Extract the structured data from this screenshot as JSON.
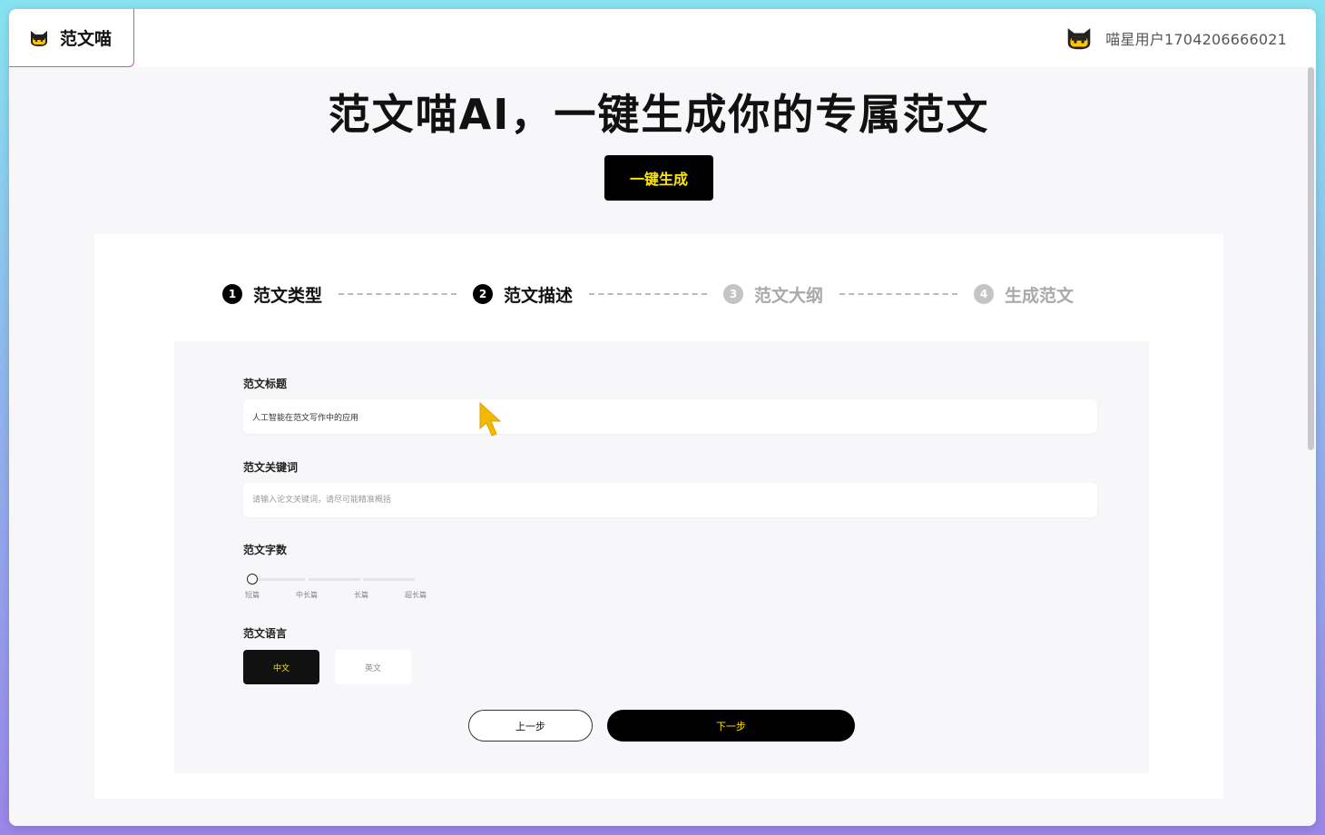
{
  "header": {
    "brand_name": "范文喵",
    "brand_icon": "cat-logo-icon",
    "user_name": "喵星用户1704206666021",
    "user_icon": "cat-avatar-icon"
  },
  "hero": {
    "title": "范文喵AI，一键生成你的专属范文",
    "button_label": "一键生成"
  },
  "steps": [
    {
      "num": "1",
      "label": "范文类型",
      "state": "done"
    },
    {
      "num": "2",
      "label": "范文描述",
      "state": "current"
    },
    {
      "num": "3",
      "label": "范文大纲",
      "state": "pending"
    },
    {
      "num": "4",
      "label": "生成范文",
      "state": "pending"
    }
  ],
  "form": {
    "title_label": "范文标题",
    "title_value": "人工智能在范文写作中的应用",
    "keywords_label": "范文关键词",
    "keywords_placeholder": "请输入论文关键词，请尽可能精准概括",
    "length_label": "范文字数",
    "length_options": [
      "短篇",
      "中长篇",
      "长篇",
      "超长篇"
    ],
    "length_selected": "短篇",
    "language_label": "范文语言",
    "language_options": [
      "中文",
      "英文"
    ],
    "language_selected": "中文",
    "prev_label": "上一步",
    "next_label": "下一步"
  },
  "colors": {
    "accent_yellow": "#ffe600",
    "primary_black": "#000000",
    "panel_bg": "#f7f7f9",
    "brand_border": "#b85cc8",
    "cursor": "#f5b800"
  }
}
